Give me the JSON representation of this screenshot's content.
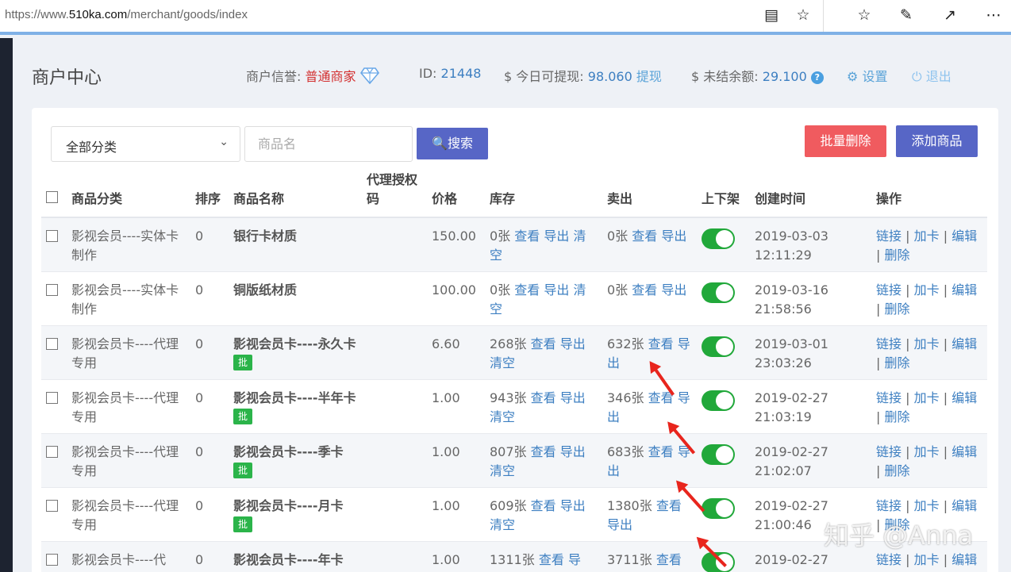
{
  "browser": {
    "url_prefix": "https://www.",
    "url_domain": "510ka.com",
    "url_path": "/merchant/goods/index"
  },
  "header": {
    "brand": "商户中心",
    "reputation_label": "商户信誉:",
    "reputation_value": "普通商家",
    "id_label": "ID:",
    "id_value": "21448",
    "withdrawable_label": "$ 今日可提现:",
    "withdrawable_value": "98.060",
    "withdraw_link": "提现",
    "unsettled_label": "$ 未结余额:",
    "unsettled_value": "29.100",
    "settings": "设置",
    "logout": "退出"
  },
  "toolbar": {
    "category_select": "全部分类",
    "name_placeholder": "商品名",
    "search_label": "搜索",
    "batch_delete_label": "批量删除",
    "add_goods_label": "添加商品"
  },
  "table": {
    "columns": [
      "商品分类",
      "排序",
      "商品名称",
      "代理授权码",
      "价格",
      "库存",
      "卖出",
      "上下架",
      "创建时间",
      "操作"
    ],
    "rows": [
      {
        "category": "影视会员----实体卡制作",
        "sort": "0",
        "name": "银行卡材质",
        "batch": false,
        "price": "150.00",
        "stock": "0张",
        "stock_links": [
          "查看",
          "导出",
          "清空"
        ],
        "sold": "0张",
        "sold_links": [
          "查看",
          "导出"
        ],
        "on_shelf": true,
        "created": "2019-03-03 12:11:29"
      },
      {
        "category": "影视会员----实体卡制作",
        "sort": "0",
        "name": "铜版纸材质",
        "batch": false,
        "price": "100.00",
        "stock": "0张",
        "stock_links": [
          "查看",
          "导出",
          "清空"
        ],
        "sold": "0张",
        "sold_links": [
          "查看",
          "导出"
        ],
        "on_shelf": true,
        "created": "2019-03-16 21:58:56"
      },
      {
        "category": "影视会员卡----代理专用",
        "sort": "0",
        "name": "影视会员卡----永久卡",
        "batch": true,
        "price": "6.60",
        "stock": "268张",
        "stock_links": [
          "查看",
          "导出",
          "清空"
        ],
        "sold": "632张",
        "sold_links": [
          "查看",
          "导出"
        ],
        "on_shelf": true,
        "created": "2019-03-01 23:03:26"
      },
      {
        "category": "影视会员卡----代理专用",
        "sort": "0",
        "name": "影视会员卡----半年卡",
        "batch": true,
        "price": "1.00",
        "stock": "943张",
        "stock_links": [
          "查看",
          "导出",
          "清空"
        ],
        "sold": "346张",
        "sold_links": [
          "查看",
          "导出"
        ],
        "on_shelf": true,
        "created": "2019-02-27 21:03:19"
      },
      {
        "category": "影视会员卡----代理专用",
        "sort": "0",
        "name": "影视会员卡----季卡",
        "batch": true,
        "price": "1.00",
        "stock": "807张",
        "stock_links": [
          "查看",
          "导出",
          "清空"
        ],
        "sold": "683张",
        "sold_links": [
          "查看",
          "导出"
        ],
        "on_shelf": true,
        "created": "2019-02-27 21:02:07"
      },
      {
        "category": "影视会员卡----代理专用",
        "sort": "0",
        "name": "影视会员卡----月卡",
        "batch": true,
        "price": "1.00",
        "stock": "609张",
        "stock_links": [
          "查看",
          "导出",
          "清空"
        ],
        "sold": "1380张",
        "sold_links": [
          "查看",
          "导出"
        ],
        "on_shelf": true,
        "created": "2019-02-27 21:00:46"
      },
      {
        "category": "影视会员卡----代",
        "sort": "0",
        "name": "影视会员卡----年卡",
        "batch": false,
        "price": "1.00",
        "stock": "1311张",
        "stock_links": [
          "查看",
          "导"
        ],
        "sold": "3711张",
        "sold_links": [
          "查看"
        ],
        "on_shelf": true,
        "created": "2019-02-27"
      }
    ],
    "batch_badge": "批",
    "actions": [
      "链接",
      "加卡",
      "编辑",
      "删除"
    ],
    "action_sep": "|"
  },
  "watermark": "知乎 @Anna",
  "colors": {
    "primary": "#5766c6",
    "danger": "#f05b5f",
    "link": "#3d7fc1",
    "toggle_on": "#21a83a",
    "badge": "#2bb44a"
  }
}
